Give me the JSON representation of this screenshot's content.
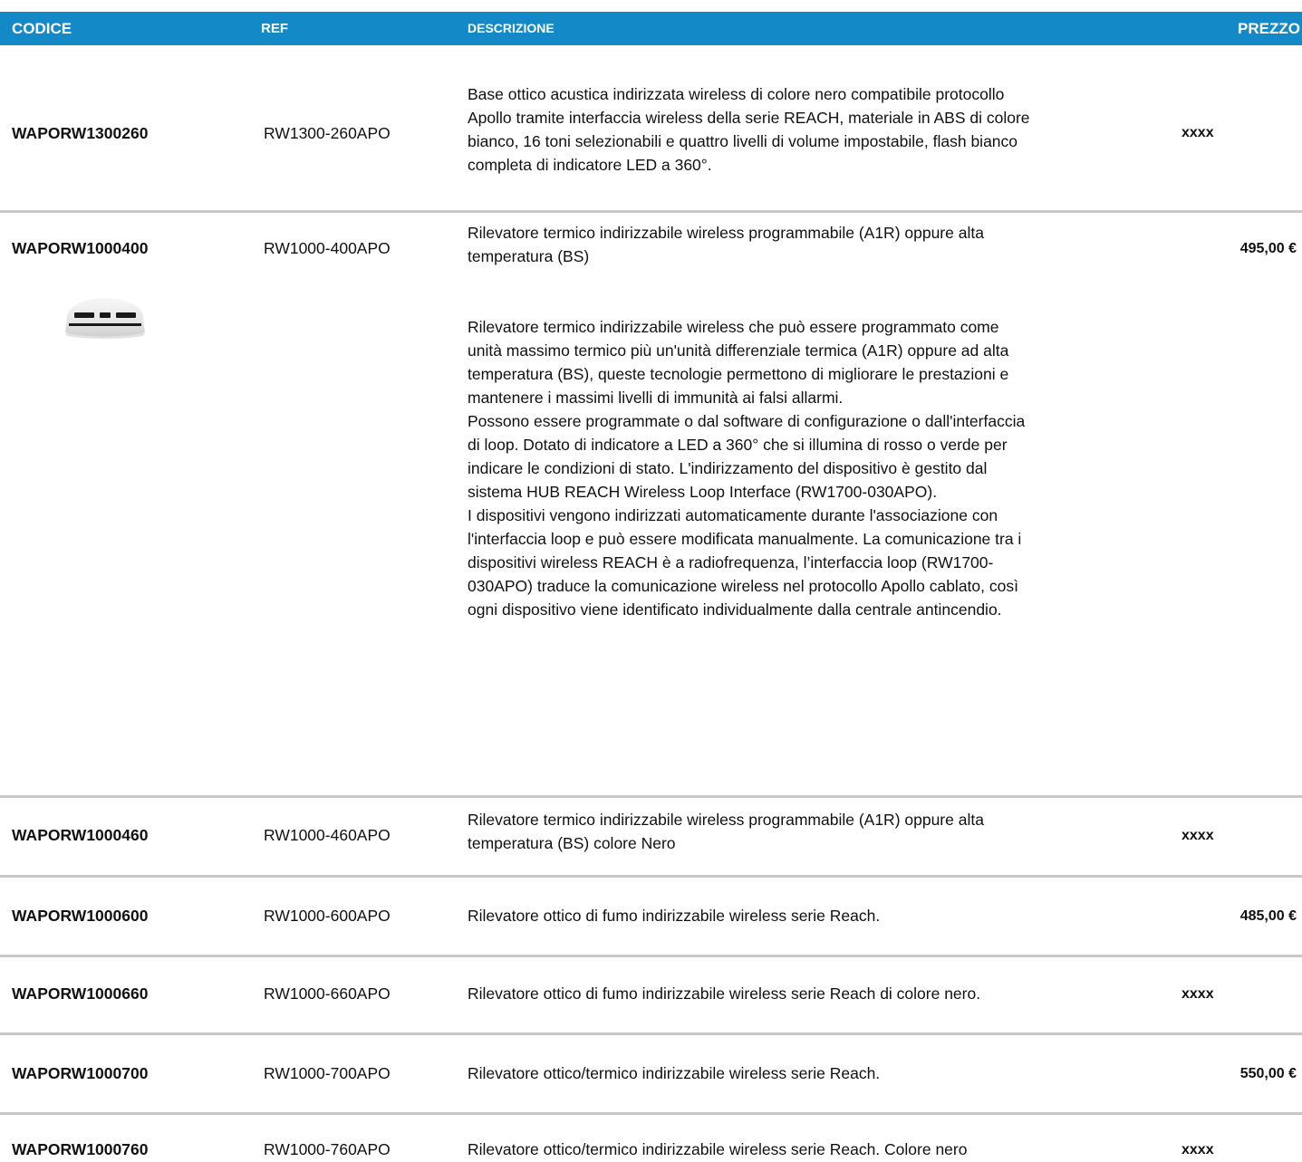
{
  "header": {
    "codice": "CODICE",
    "ref": "REF",
    "descrizione": "DESCRIZIONE",
    "prezzo": "PREZZO"
  },
  "rows": [
    {
      "code": "WAPORW1300260",
      "ref": "RW1300-260APO",
      "desc_lines": [
        "Base ottico acustica indirizzata wireless di colore nero compatibile protocollo",
        "Apollo tramite interfaccia wireless della serie REACH, materiale in ABS di colore",
        "bianco, 16 toni selezionabili e quattro livelli di volume impostabile, flash bianco",
        "completa di indicatore LED a 360°."
      ],
      "price": "xxxx"
    },
    {
      "code": "WAPORW1000400",
      "ref": "RW1000-400APO",
      "desc_lines": [
        "Rilevatore termico indirizzabile wireless programmabile (A1R) oppure alta",
        "temperatura (BS)"
      ],
      "price": "495,00 €"
    },
    {
      "code": "WAPORW1000460",
      "ref": "RW1000-460APO",
      "desc_lines": [
        "Rilevatore termico indirizzabile wireless programmabile (A1R) oppure alta",
        "temperatura (BS) colore Nero"
      ],
      "price": "xxxx"
    },
    {
      "code": "WAPORW1000600",
      "ref": "RW1000-600APO",
      "desc_lines": [
        "Rilevatore ottico di fumo indirizzabile wireless serie Reach."
      ],
      "price": "485,00 €"
    },
    {
      "code": "WAPORW1000660",
      "ref": "RW1000-660APO",
      "desc_lines": [
        "Rilevatore ottico di fumo indirizzabile wireless serie Reach di colore nero."
      ],
      "price": "xxxx"
    },
    {
      "code": "WAPORW1000700",
      "ref": "RW1000-700APO",
      "desc_lines": [
        "Rilevatore ottico/termico indirizzabile wireless serie Reach."
      ],
      "price": "550,00 €"
    },
    {
      "code": "WAPORW1000760",
      "ref": "RW1000-760APO",
      "desc_lines": [
        "Rilevatore ottico/termico indirizzabile wireless serie Reach. Colore nero"
      ],
      "price": "xxxx"
    }
  ],
  "detail": {
    "lines": [
      "Rilevatore termico indirizzabile wireless che può essere programmato come",
      "unità massimo termico più un'unità differenziale termica (A1R) oppure ad alta",
      "temperatura (BS), queste tecnologie permettono di migliorare le prestazioni e",
      "mantenere i massimi livelli di immunità ai falsi allarmi.",
      "Possono essere programmate o dal software di configurazione o dall'interfaccia",
      "di loop. Dotato di indicatore a LED a 360° che si illumina di rosso o verde per",
      "indicare le condizioni di stato. L'indirizzamento del dispositivo è gestito dal",
      "sistema HUB REACH Wireless Loop Interface (RW1700-030APO).",
      "I dispositivi vengono indirizzati automaticamente durante l'associazione con",
      "l'interfaccia loop e può essere modificata manualmente. La comunicazione tra i",
      "dispositivi wireless REACH è a radiofrequenza, l’interfaccia loop (RW1700-",
      "030APO) traduce la comunicazione wireless nel protocollo Apollo cablato, così",
      "ogni dispositivo viene identificato individualmente dalla centrale antincendio."
    ]
  },
  "colors": {
    "header_bg": "#1489c8",
    "header_text": "#ffffff",
    "divider": "#c8c8c8"
  },
  "icons": {
    "detector_image": "heat-detector-image"
  }
}
